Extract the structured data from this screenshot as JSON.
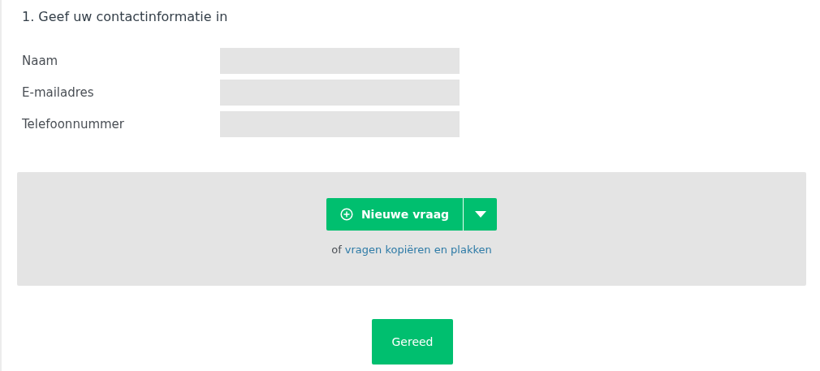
{
  "question": {
    "title": "1. Geef uw contactinformatie in",
    "fields": [
      {
        "label": "Naam"
      },
      {
        "label": "E-mailadres"
      },
      {
        "label": "Telefoonnummer"
      }
    ]
  },
  "add_panel": {
    "button": "Nieuwe vraag",
    "prefix": "of",
    "link": "vragen kopiëren en plakken"
  },
  "done_button": "Gereed"
}
